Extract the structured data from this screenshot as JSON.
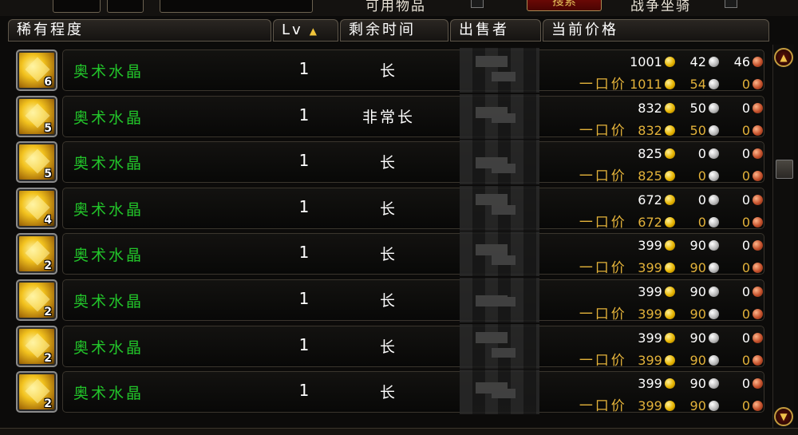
{
  "top": {
    "label_left": "可用物品",
    "search_button": "搜索",
    "label_right": "战争坐骑"
  },
  "columns": {
    "rarity": "稀有程度",
    "lv": "Lv",
    "time_left": "剩余时间",
    "seller": "出售者",
    "current_price": "当前价格"
  },
  "buyout_label": "一口价",
  "rows": [
    {
      "name": "奥术水晶",
      "count": "6",
      "lv": "1",
      "time": "长",
      "bid": {
        "g": "1001",
        "s": "42",
        "c": "46"
      },
      "buyout": {
        "g": "1011",
        "s": "54",
        "c": "0"
      }
    },
    {
      "name": "奥术水晶",
      "count": "5",
      "lv": "1",
      "time": "非常长",
      "bid": {
        "g": "832",
        "s": "50",
        "c": "0"
      },
      "buyout": {
        "g": "832",
        "s": "50",
        "c": "0"
      }
    },
    {
      "name": "奥术水晶",
      "count": "5",
      "lv": "1",
      "time": "长",
      "bid": {
        "g": "825",
        "s": "0",
        "c": "0"
      },
      "buyout": {
        "g": "825",
        "s": "0",
        "c": "0"
      }
    },
    {
      "name": "奥术水晶",
      "count": "4",
      "lv": "1",
      "time": "长",
      "bid": {
        "g": "672",
        "s": "0",
        "c": "0"
      },
      "buyout": {
        "g": "672",
        "s": "0",
        "c": "0"
      }
    },
    {
      "name": "奥术水晶",
      "count": "2",
      "lv": "1",
      "time": "长",
      "bid": {
        "g": "399",
        "s": "90",
        "c": "0"
      },
      "buyout": {
        "g": "399",
        "s": "90",
        "c": "0"
      }
    },
    {
      "name": "奥术水晶",
      "count": "2",
      "lv": "1",
      "time": "长",
      "bid": {
        "g": "399",
        "s": "90",
        "c": "0"
      },
      "buyout": {
        "g": "399",
        "s": "90",
        "c": "0"
      }
    },
    {
      "name": "奥术水晶",
      "count": "2",
      "lv": "1",
      "time": "长",
      "bid": {
        "g": "399",
        "s": "90",
        "c": "0"
      },
      "buyout": {
        "g": "399",
        "s": "90",
        "c": "0"
      }
    },
    {
      "name": "奥术水晶",
      "count": "2",
      "lv": "1",
      "time": "长",
      "bid": {
        "g": "399",
        "s": "90",
        "c": "0"
      },
      "buyout": {
        "g": "399",
        "s": "90",
        "c": "0"
      }
    }
  ],
  "icons": {
    "item": "arcane-crystal-icon",
    "sort": "sort-ascending-arrow-icon",
    "scroll_up": "scroll-up-icon",
    "scroll_down": "scroll-down-icon"
  }
}
